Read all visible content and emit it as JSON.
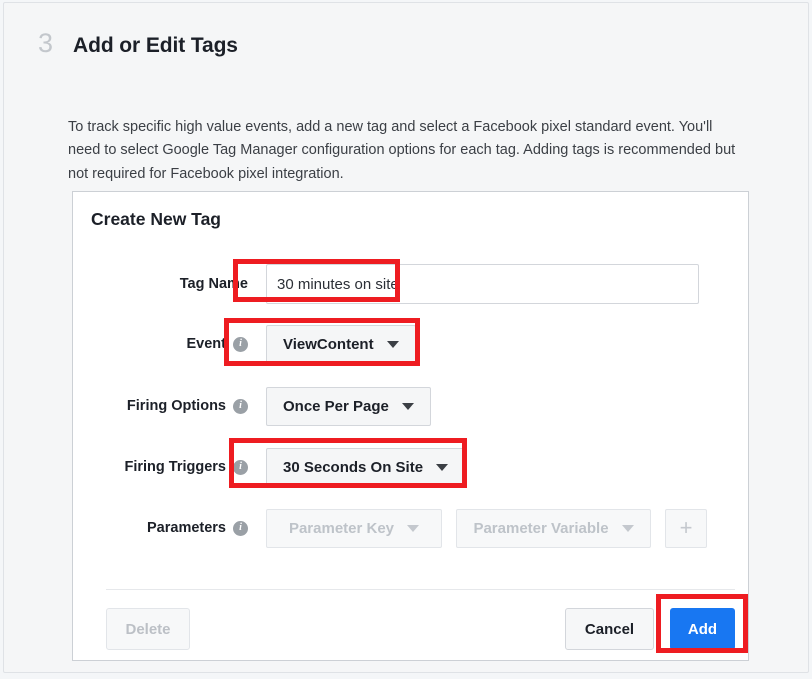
{
  "step": {
    "number": "3",
    "title": "Add or Edit Tags",
    "description": "To track specific high value events, add a new tag and select a Facebook pixel standard event. You'll need to select Google Tag Manager configuration options for each tag. Adding tags is recommended but not required for Facebook pixel integration."
  },
  "panel": {
    "title": "Create New Tag",
    "fields": {
      "tag_name": {
        "label": "Tag Name",
        "value": "30 minutes on site",
        "placeholder": ""
      },
      "event": {
        "label": "Event",
        "value": "ViewContent",
        "info_icon": "info-icon"
      },
      "firing_options": {
        "label": "Firing Options",
        "value": "Once Per Page",
        "info_icon": "info-icon"
      },
      "firing_triggers": {
        "label": "Firing Triggers",
        "value": "30 Seconds On Site",
        "info_icon": "info-icon"
      },
      "parameters": {
        "label": "Parameters",
        "info_icon": "info-icon",
        "key_placeholder": "Parameter Key",
        "variable_placeholder": "Parameter Variable",
        "add_label": "+"
      }
    },
    "footer": {
      "delete_label": "Delete",
      "cancel_label": "Cancel",
      "add_label": "Add"
    }
  },
  "colors": {
    "accent_blue": "#1877f2",
    "annotation_red": "#ee1c21",
    "page_background": "#f5f6f7",
    "panel_background": "#ffffff",
    "border": "#ccd0d5"
  },
  "annotations": [
    {
      "name": "highlight-tag-name",
      "target": "tag_name"
    },
    {
      "name": "highlight-event",
      "target": "event"
    },
    {
      "name": "highlight-firing-triggers",
      "target": "firing_triggers"
    },
    {
      "name": "highlight-add-button",
      "target": "add_button"
    }
  ]
}
